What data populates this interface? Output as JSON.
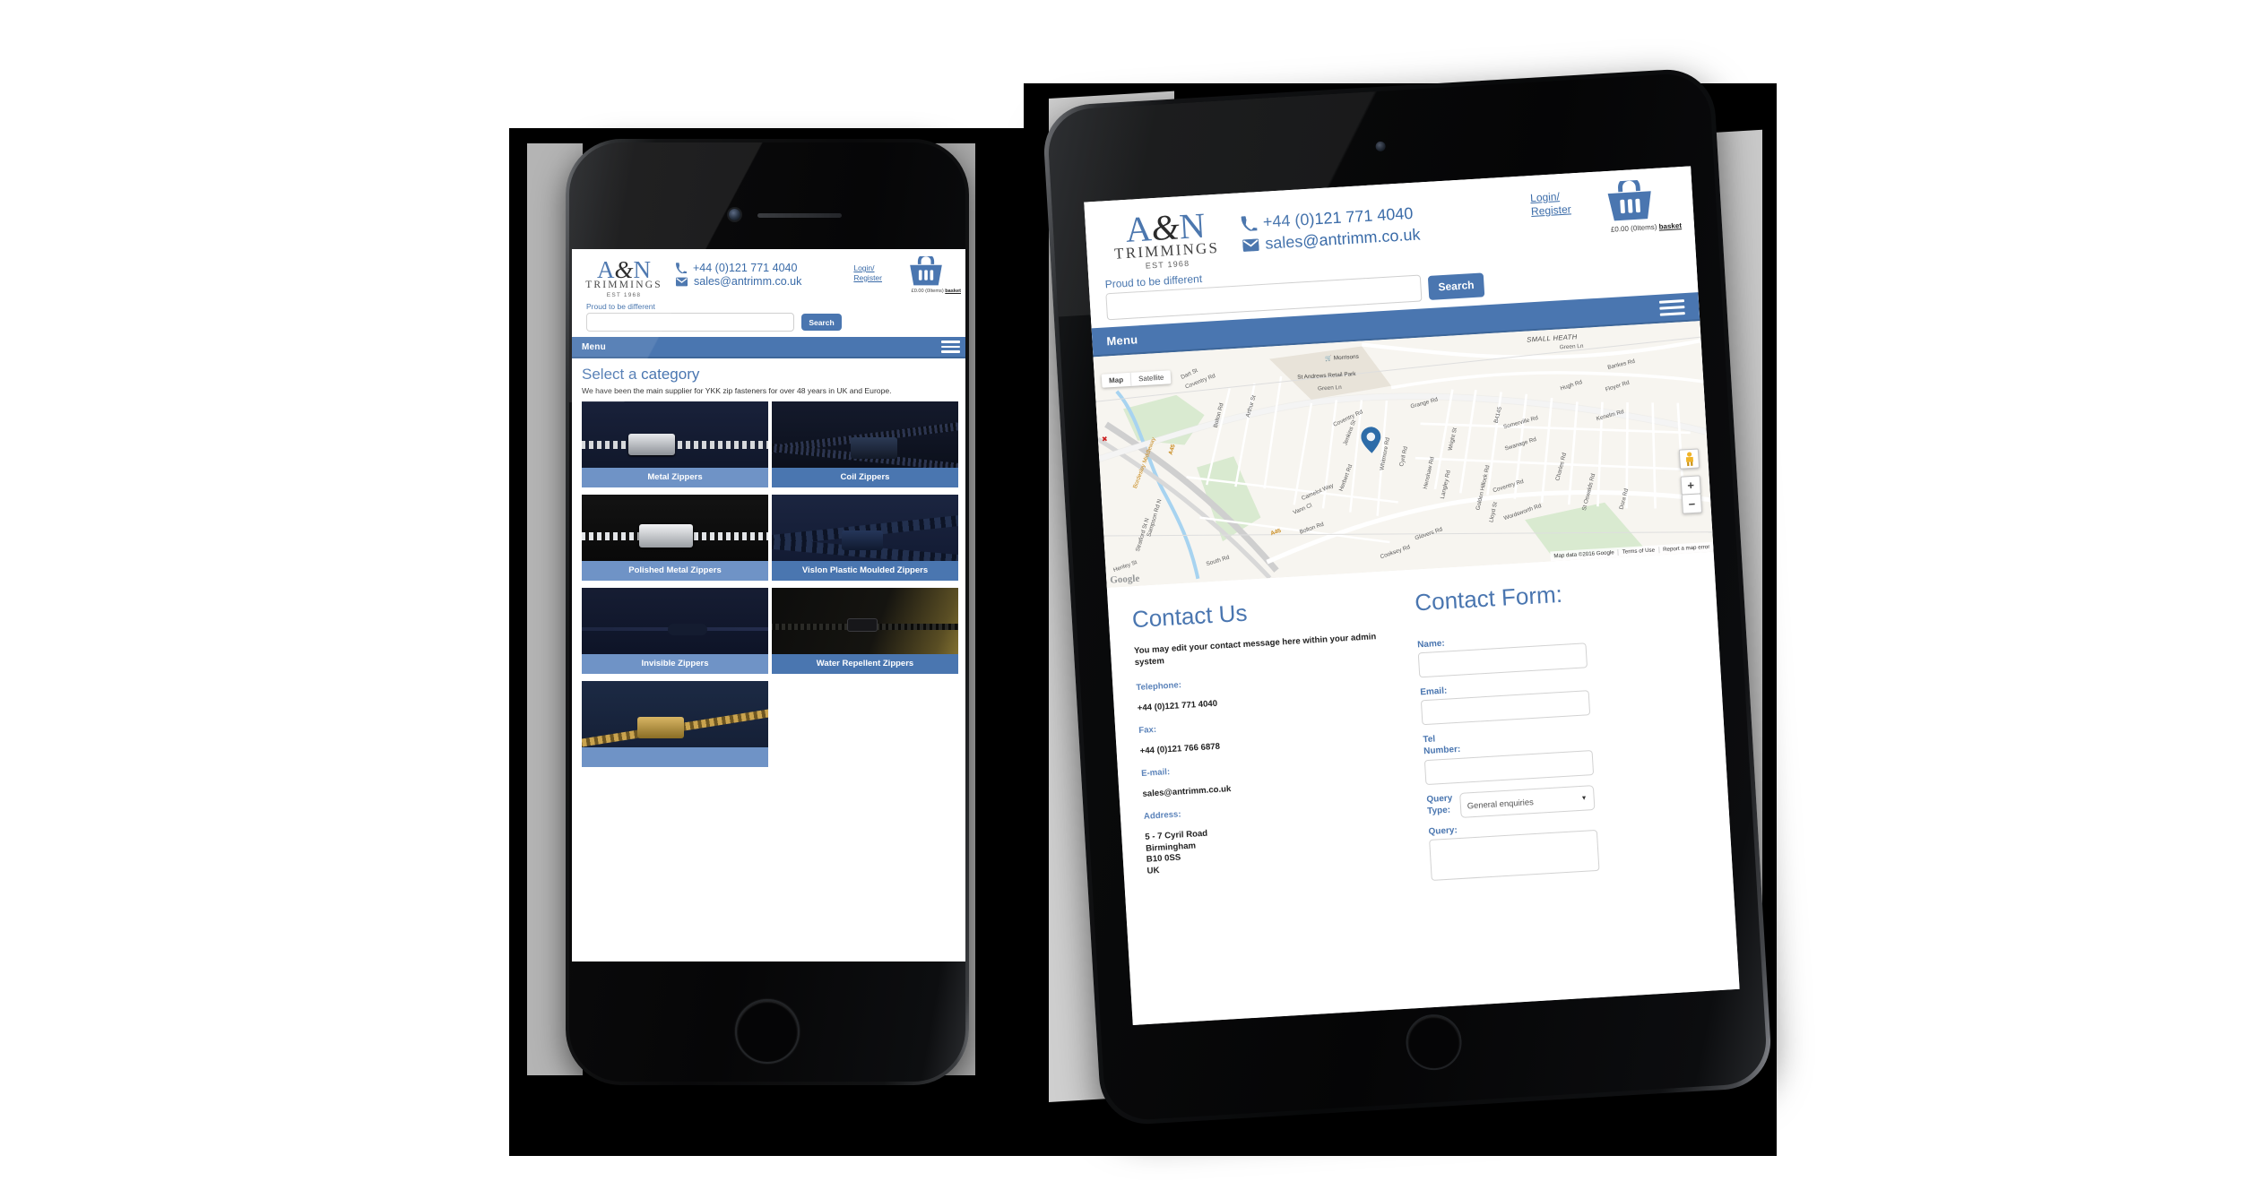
{
  "brand": {
    "logo_a": "A",
    "logo_amp": "&",
    "logo_n": "N",
    "logo_word": "TRIMMINGS",
    "logo_est": "EST 1968",
    "accent_blue": "#4a76b0",
    "logo_blue": "#3e6ca8",
    "cap_light": "#6f93c6",
    "cap_dark": "#4a76b0"
  },
  "header": {
    "phone": "+44 (0)121 771 4040",
    "email": "sales@antrimm.co.uk",
    "login_line1": "Login/",
    "login_line2": "Register",
    "basket_total": "£0.00 (0Items)",
    "basket_label": "basket",
    "tagline": "Proud to be different",
    "search_value": "",
    "search_placeholder": "",
    "search_button": "Search",
    "menu_label": "Menu"
  },
  "phone_page": {
    "heading": "Select a category",
    "subheading": "We have been the main supplier for YKK zip fasteners for over 48 years in UK and Europe.",
    "categories": [
      {
        "label": "Metal Zippers",
        "cap": "light"
      },
      {
        "label": "Coil Zippers",
        "cap": "dark"
      },
      {
        "label": "Polished Metal Zippers",
        "cap": "light"
      },
      {
        "label": "Vislon Plastic Moulded Zippers",
        "cap": "dark"
      },
      {
        "label": "Invisible Zippers",
        "cap": "light"
      },
      {
        "label": "Water Repellent Zippers",
        "cap": "dark"
      },
      {
        "label": "",
        "cap": "light"
      }
    ]
  },
  "tablet_page": {
    "map": {
      "type_map": "Map",
      "type_satellite": "Satellite",
      "zoom_in": "+",
      "zoom_out": "−",
      "watermark": "Google",
      "attribution": [
        "Map data ©2016 Google",
        "Terms of Use",
        "Report a map error"
      ],
      "labels": [
        "SMALL HEATH",
        "Green Ln",
        "Morrisons",
        "St Andrews Retail Park",
        "Green Ln",
        "Coventry Rd",
        "Dart St",
        "Grange Rd",
        "Bankes Rd",
        "Hugh Rd",
        "Floyer Rd",
        "Kenelm Rd",
        "Somerville Rd",
        "Swanage Rd",
        "Charles Rd",
        "St Oswalds Rd",
        "Dora Rd",
        "B4145",
        "Wright St",
        "Cyril Rd",
        "Henshaw Rd",
        "Langley Rd",
        "Golden Hillock Rd",
        "Lloyd St",
        "Wordsworth Rd",
        "Glovers Rd",
        "Cooksey Rd",
        "Coventry Rd",
        "Whitmore Rd",
        "Jenkins St",
        "Herbert Rd",
        "Camelot Way",
        "Vann Cl",
        "Bolton Rd",
        "Arthur St",
        "Bolton Rd",
        "South Rd",
        "A45",
        "A45",
        "Bordesley Middleway",
        "Sampson Rd N",
        "Stratford St N",
        "Henley St"
      ]
    },
    "contact": {
      "title": "Contact Us",
      "message": "You may edit your contact message here within your admin system",
      "tel_label": "Telephone:",
      "tel_value": "+44 (0)121 771 4040",
      "fax_label": "Fax:",
      "fax_value": "+44 (0)121 766 6878",
      "email_label": "E-mail:",
      "email_value": "sales@antrimm.co.uk",
      "address_label": "Address:",
      "address_value": "5 - 7 Cyril Road\nBirmingham\nB10 0SS\nUK"
    },
    "form": {
      "title": "Contact Form:",
      "name_label": "Name:",
      "name_value": "",
      "email_label": "Email:",
      "email_value": "",
      "tel_label_l1": "Tel",
      "tel_label_l2": "Number:",
      "tel_value": "",
      "query_type_label_l1": "Query",
      "query_type_label_l2": "Type:",
      "query_type_value": "General enquiries",
      "query_label": "Query:",
      "query_value": ""
    }
  }
}
